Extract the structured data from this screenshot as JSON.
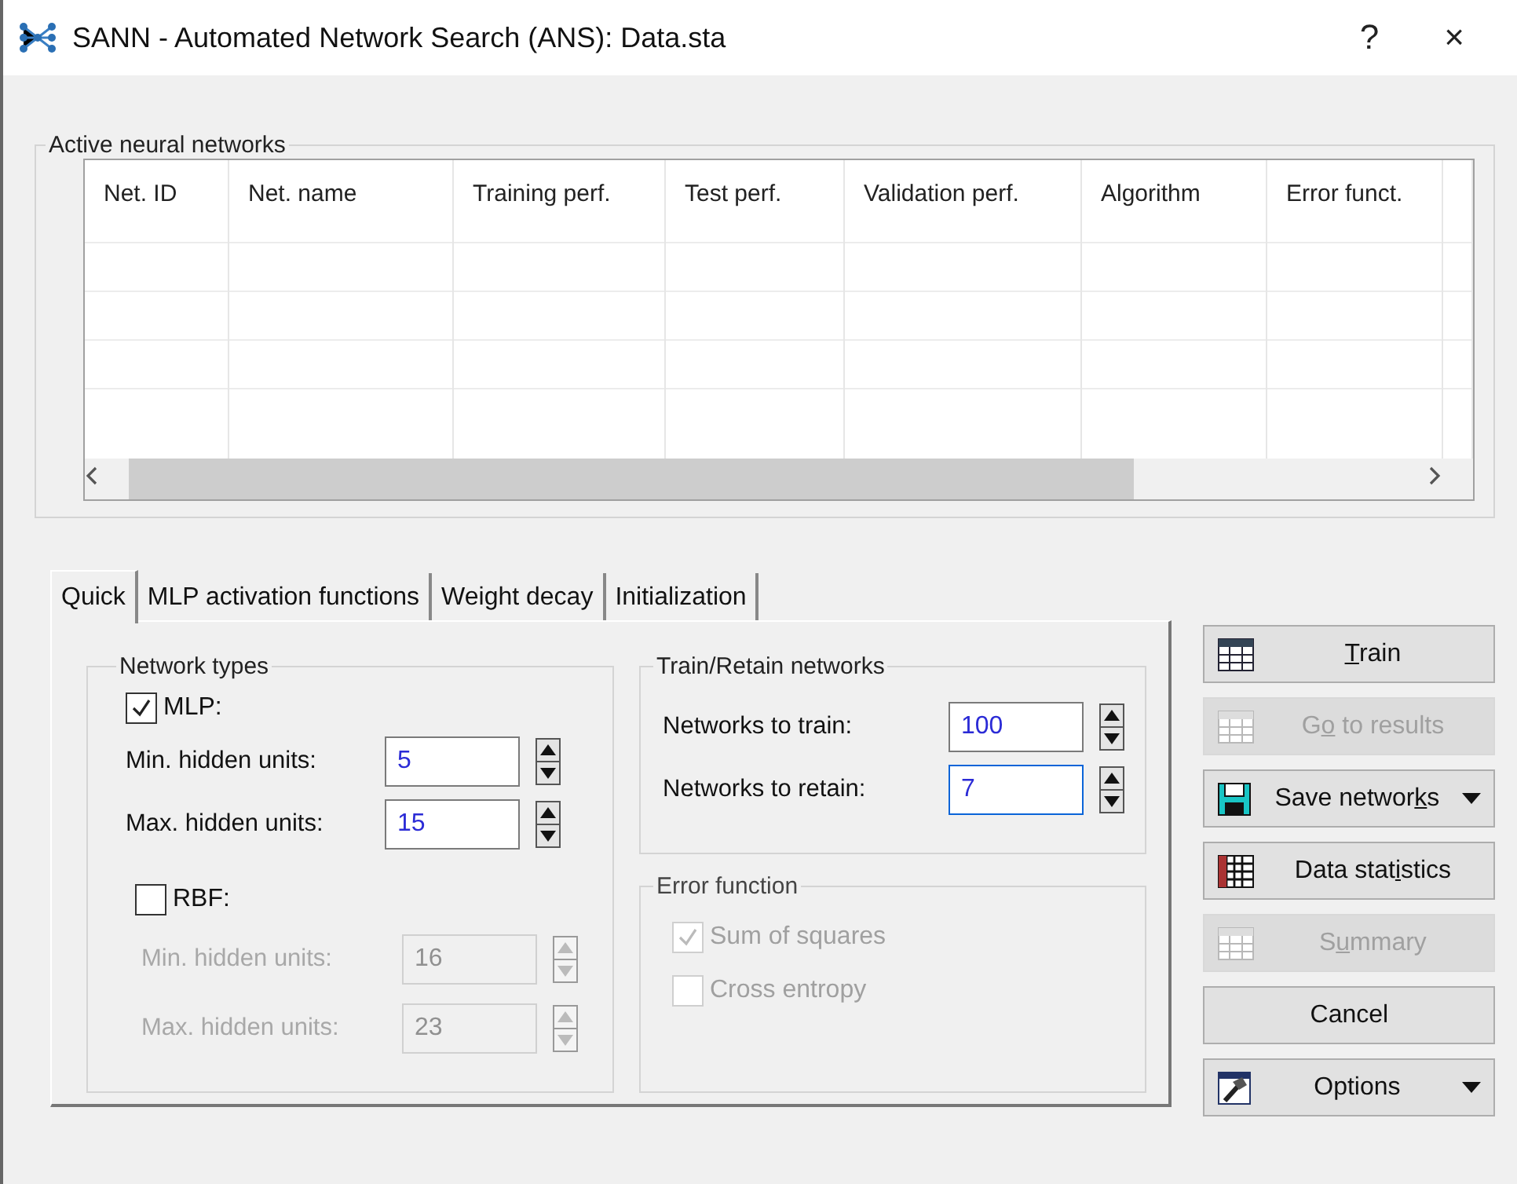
{
  "window": {
    "title": "SANN - Automated Network Search (ANS): Data.sta",
    "help": "?",
    "close": "×"
  },
  "networks": {
    "label": "Active neural networks",
    "columns": [
      "Net. ID",
      "Net. name",
      "Training perf.",
      "Test perf.",
      "Validation perf.",
      "Algorithm",
      "Error funct."
    ]
  },
  "tabs": [
    {
      "label": "Quick",
      "selected": true
    },
    {
      "label": "MLP activation functions",
      "selected": false
    },
    {
      "label": "Weight decay",
      "selected": false
    },
    {
      "label": "Initialization",
      "selected": false
    }
  ],
  "network_types": {
    "label": "Network types",
    "types": [
      {
        "label": "MLP:",
        "checked": true,
        "fields": [
          {
            "label": "Min. hidden units:",
            "value": "5",
            "disabled": false
          },
          {
            "label": "Max. hidden units:",
            "value": "15",
            "disabled": false
          }
        ]
      },
      {
        "label": "RBF:",
        "checked": false,
        "fields": [
          {
            "label": "Min. hidden units:",
            "value": "16",
            "disabled": true
          },
          {
            "label": "Max. hidden units:",
            "value": "23",
            "disabled": true
          }
        ]
      }
    ]
  },
  "train_retain": {
    "label": "Train/Retain networks",
    "fields": [
      {
        "label": "Networks to train:",
        "value": "100",
        "focused": false
      },
      {
        "label": "Networks to retain:",
        "value": "7",
        "focused": true
      }
    ]
  },
  "error_function": {
    "label": "Error function",
    "options": [
      {
        "label": "Sum of squares",
        "checked": true,
        "disabled": true
      },
      {
        "label": "Cross entropy",
        "checked": false,
        "disabled": true
      }
    ]
  },
  "buttons": [
    {
      "label_parts": [
        {
          "text": "T",
          "underlined": true
        },
        {
          "text": "rain",
          "underlined": false
        }
      ],
      "disabled": false,
      "dropdown": false
    },
    {
      "label_parts": [
        {
          "text": "G",
          "underlined": false
        },
        {
          "text": "o",
          "underlined": true
        },
        {
          "text": " to results",
          "underlined": false
        }
      ],
      "disabled": true,
      "dropdown": false
    },
    {
      "label_parts": [
        {
          "text": "Save networ",
          "underlined": false
        },
        {
          "text": "k",
          "underlined": true
        },
        {
          "text": "s",
          "underlined": false
        }
      ],
      "disabled": false,
      "dropdown": true
    },
    {
      "label_parts": [
        {
          "text": "Data stat",
          "underlined": false
        },
        {
          "text": "i",
          "underlined": true
        },
        {
          "text": "stics",
          "underlined": false
        }
      ],
      "disabled": false,
      "dropdown": false
    },
    {
      "label_parts": [
        {
          "text": "S",
          "underlined": false
        },
        {
          "text": "u",
          "underlined": true
        },
        {
          "text": "mmary",
          "underlined": false
        }
      ],
      "disabled": true,
      "dropdown": false
    },
    {
      "label_parts": [
        {
          "text": "Cancel",
          "underlined": false
        }
      ],
      "disabled": false,
      "dropdown": false
    },
    {
      "label_parts": [
        {
          "text": "Options",
          "underlined": false
        }
      ],
      "disabled": false,
      "dropdown": true
    }
  ]
}
